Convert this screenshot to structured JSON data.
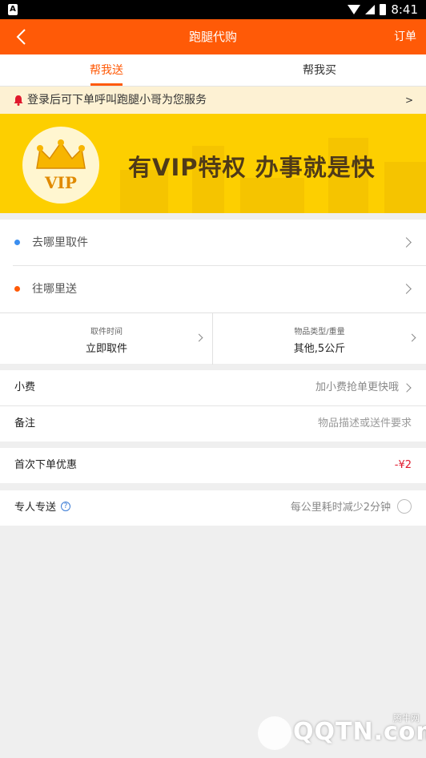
{
  "status_bar": {
    "left_icon": "A",
    "time": "8:41",
    "icons": [
      "wifi-icon",
      "signal-icon",
      "battery-icon"
    ]
  },
  "nav": {
    "title": "跑腿代购",
    "right_label": "订单",
    "back_icon": "chevron-left-icon"
  },
  "tabs": [
    {
      "label": "帮我送",
      "active": true
    },
    {
      "label": "帮我买",
      "active": false
    }
  ],
  "notice": {
    "icon": "bell-icon",
    "text": "登录后可下单呼叫跑腿小哥为您服务",
    "arrow": ">"
  },
  "banner": {
    "badge_text": "VIP",
    "slogan": "有VIP特权 办事就是快",
    "icon": "crown-icon"
  },
  "addresses": {
    "pickup": {
      "label": "去哪里取件",
      "dot_color": "#3a8ef0"
    },
    "dropoff": {
      "label": "往哪里送",
      "dot_color": "#ff5a07"
    }
  },
  "split": {
    "time_label": "取件时间",
    "time_value": "立即取件",
    "goods_label": "物品类型/重量",
    "goods_value": "其他,5公斤"
  },
  "tip": {
    "label": "小费",
    "value": "加小费抢单更快哦"
  },
  "note": {
    "label": "备注",
    "placeholder": "物品描述或送件要求"
  },
  "first_order": {
    "label": "首次下单优惠",
    "value": "-¥2"
  },
  "dedicated": {
    "label": "专人专送",
    "help": "?",
    "value": "每公里耗时减少2分钟"
  },
  "watermark": {
    "text": "QQTN.com",
    "sub": "腾牛网"
  },
  "colors": {
    "brand": "#ff5a07",
    "banner": "#fdcf00",
    "notice_bg": "#fdf1d3",
    "discount": "#e0192d"
  }
}
